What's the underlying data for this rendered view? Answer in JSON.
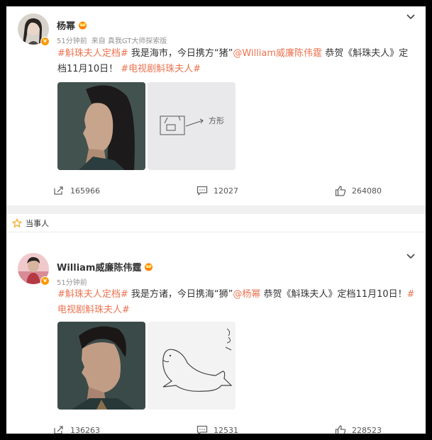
{
  "posts": [
    {
      "author": "杨幂",
      "time": "51分钟前",
      "source": "来自 真我GT大师探索版",
      "content": [
        {
          "text": "#斛珠夫人定档#",
          "hl": true
        },
        {
          "text": " 我是海市，今日携方“猪”",
          "hl": false
        },
        {
          "text": "@William威廉陈伟霆",
          "hl": true
        },
        {
          "text": " 恭贺《斛珠夫人》定档11月10日！ ",
          "hl": false
        },
        {
          "text": "#电视剧斛珠夫人#",
          "hl": true
        }
      ],
      "image_captions": [
        "",
        "方形"
      ],
      "stats": {
        "repost": "165966",
        "comment": "12027",
        "like": "264080"
      }
    },
    {
      "label": "当事人",
      "author": "William威廉陈伟霆",
      "time": "51分钟前",
      "source": "",
      "content": [
        {
          "text": "#斛珠夫人定档#",
          "hl": true
        },
        {
          "text": " 我是方诸，今日携海“狮”",
          "hl": false
        },
        {
          "text": "@杨幂",
          "hl": true
        },
        {
          "text": " 恭贺《斛珠夫人》定档11月10日！",
          "hl": false
        },
        {
          "text": "#电视剧斛珠夫人#",
          "hl": true
        }
      ],
      "stats": {
        "repost": "136263",
        "comment": "12531",
        "like": "228523"
      }
    }
  ],
  "colors": {
    "accent": "#eb7350",
    "verified": "#f79a00",
    "meta": "#939393"
  },
  "icons": [
    "chevron-down-icon",
    "star-outline-icon",
    "repost-icon",
    "comment-icon",
    "like-icon",
    "crown-badge-icon"
  ]
}
